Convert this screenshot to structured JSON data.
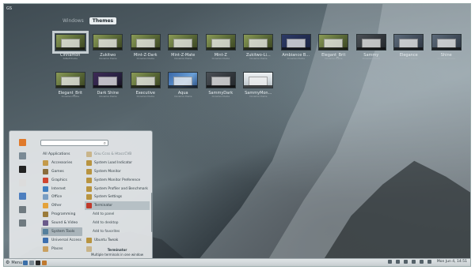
{
  "corner_label": "GS",
  "tabs": [
    {
      "label": "Windows",
      "active": false
    },
    {
      "label": "Themes",
      "active": true
    }
  ],
  "themes_row1": [
    {
      "name": "Cinnamon",
      "sub": "default theme",
      "style": "green",
      "selected": true
    },
    {
      "name": "Zukitwo",
      "sub": "Cinnamon theme",
      "style": "green"
    },
    {
      "name": "Mint-Z-Dark",
      "sub": "Cinnamon theme",
      "style": "green"
    },
    {
      "name": "Mint-Z-Mate",
      "sub": "Cinnamon theme",
      "style": "green"
    },
    {
      "name": "Mint-Z",
      "sub": "Cinnamon theme",
      "style": "green"
    },
    {
      "name": "Zukitwo-Li...",
      "sub": "Cinnamon theme",
      "style": "green"
    },
    {
      "name": "Ambiance B...",
      "sub": "Cinnamon theme",
      "style": "navy"
    },
    {
      "name": "Elegant_Brit",
      "sub": "Cinnamon theme",
      "style": "green"
    },
    {
      "name": "Sammy",
      "sub": "Cinnamon theme",
      "style": "dark"
    },
    {
      "name": "Elegance",
      "sub": "Cinnamon theme",
      "style": "slate"
    },
    {
      "name": "Shine",
      "sub": "Cinnamon theme",
      "style": "slate"
    }
  ],
  "themes_row2": [
    {
      "name": "Elegant_Brit",
      "sub": "Cinnamon theme",
      "style": "green"
    },
    {
      "name": "Dark Shine",
      "sub": "Cinnamon theme",
      "style": "purple"
    },
    {
      "name": "Executive",
      "sub": "Cinnamon theme",
      "style": "green"
    },
    {
      "name": "Aqua",
      "sub": "Cinnamon theme",
      "style": "blue"
    },
    {
      "name": "SammyDark",
      "sub": "Cinnamon theme",
      "style": "dark"
    },
    {
      "name": "SammyMon...",
      "sub": "Cinnamon theme",
      "style": "light"
    }
  ],
  "menu": {
    "favorites": [
      {
        "name": "firefox-icon",
        "color": "#e07a2a"
      },
      {
        "name": "software-icon",
        "color": "#7a8a95"
      },
      {
        "name": "terminal-icon",
        "color": "#222222"
      },
      {
        "name": "files-icon",
        "color": "#dcdcdc"
      },
      {
        "name": "settings-icon",
        "color": "#4d7fbf"
      },
      {
        "name": "lock-icon",
        "color": "#6f7a80"
      },
      {
        "name": "logout-icon",
        "color": "#6f7a80"
      }
    ],
    "search_placeholder": "",
    "categories": [
      {
        "label": "All Applications",
        "color": "",
        "active": false
      },
      {
        "label": "Accessories",
        "color": "#c49a4a",
        "active": false
      },
      {
        "label": "Games",
        "color": "#8a6d3b",
        "active": false
      },
      {
        "label": "Graphics",
        "color": "#d0452f",
        "active": false
      },
      {
        "label": "Internet",
        "color": "#3f7fc0",
        "active": false
      },
      {
        "label": "Office",
        "color": "#7a9ec2",
        "active": false
      },
      {
        "label": "Other",
        "color": "#e4a23a",
        "active": false
      },
      {
        "label": "Programming",
        "color": "#9a7b3a",
        "active": false
      },
      {
        "label": "Sound & Video",
        "color": "#6a5a8a",
        "active": false
      },
      {
        "label": "System Tools",
        "color": "#557f9c",
        "active": true
      },
      {
        "label": "Universal Access",
        "color": "#3c6fb0",
        "active": false
      },
      {
        "label": "Places",
        "color": "#c9a060",
        "active": false
      }
    ],
    "apps": [
      {
        "label": "Gnu Ccss & HtaccCVB",
        "dim": true,
        "sub": false,
        "hover": false
      },
      {
        "label": "System Load Indicator",
        "dim": false,
        "sub": false,
        "hover": false
      },
      {
        "label": "System Monitor",
        "dim": false,
        "sub": false,
        "hover": false
      },
      {
        "label": "System Monitor Preference",
        "dim": false,
        "sub": false,
        "hover": false
      },
      {
        "label": "System Profiler and Benchmark",
        "dim": false,
        "sub": false,
        "hover": false
      },
      {
        "label": "System Settings",
        "dim": false,
        "sub": false,
        "hover": false
      },
      {
        "label": "Terminator",
        "dim": false,
        "sub": false,
        "hover": true
      },
      {
        "label": "Add to panel",
        "dim": false,
        "sub": true,
        "hover": false
      },
      {
        "label": "Add to desktop",
        "dim": false,
        "sub": true,
        "hover": false
      },
      {
        "label": "Add to favorites",
        "dim": false,
        "sub": true,
        "hover": false
      },
      {
        "label": "Ubuntu Tweak",
        "dim": false,
        "sub": false,
        "hover": false
      },
      {
        "label": "",
        "dim": true,
        "sub": false,
        "hover": false
      }
    ],
    "desc_title": "Terminator",
    "desc_text": "Multiple terminals in one window"
  },
  "taskbar": {
    "menu_label": "Menu",
    "launchers": [
      {
        "name": "show-desktop-icon",
        "color": "#3b6fa8"
      },
      {
        "name": "files-launcher-icon",
        "color": "#7b8a94"
      },
      {
        "name": "terminal-launcher-icon",
        "color": "#2a2a2a"
      },
      {
        "name": "browser-launcher-icon",
        "color": "#c07a30"
      }
    ],
    "clock": "Mon Jun 4, 14:51"
  }
}
